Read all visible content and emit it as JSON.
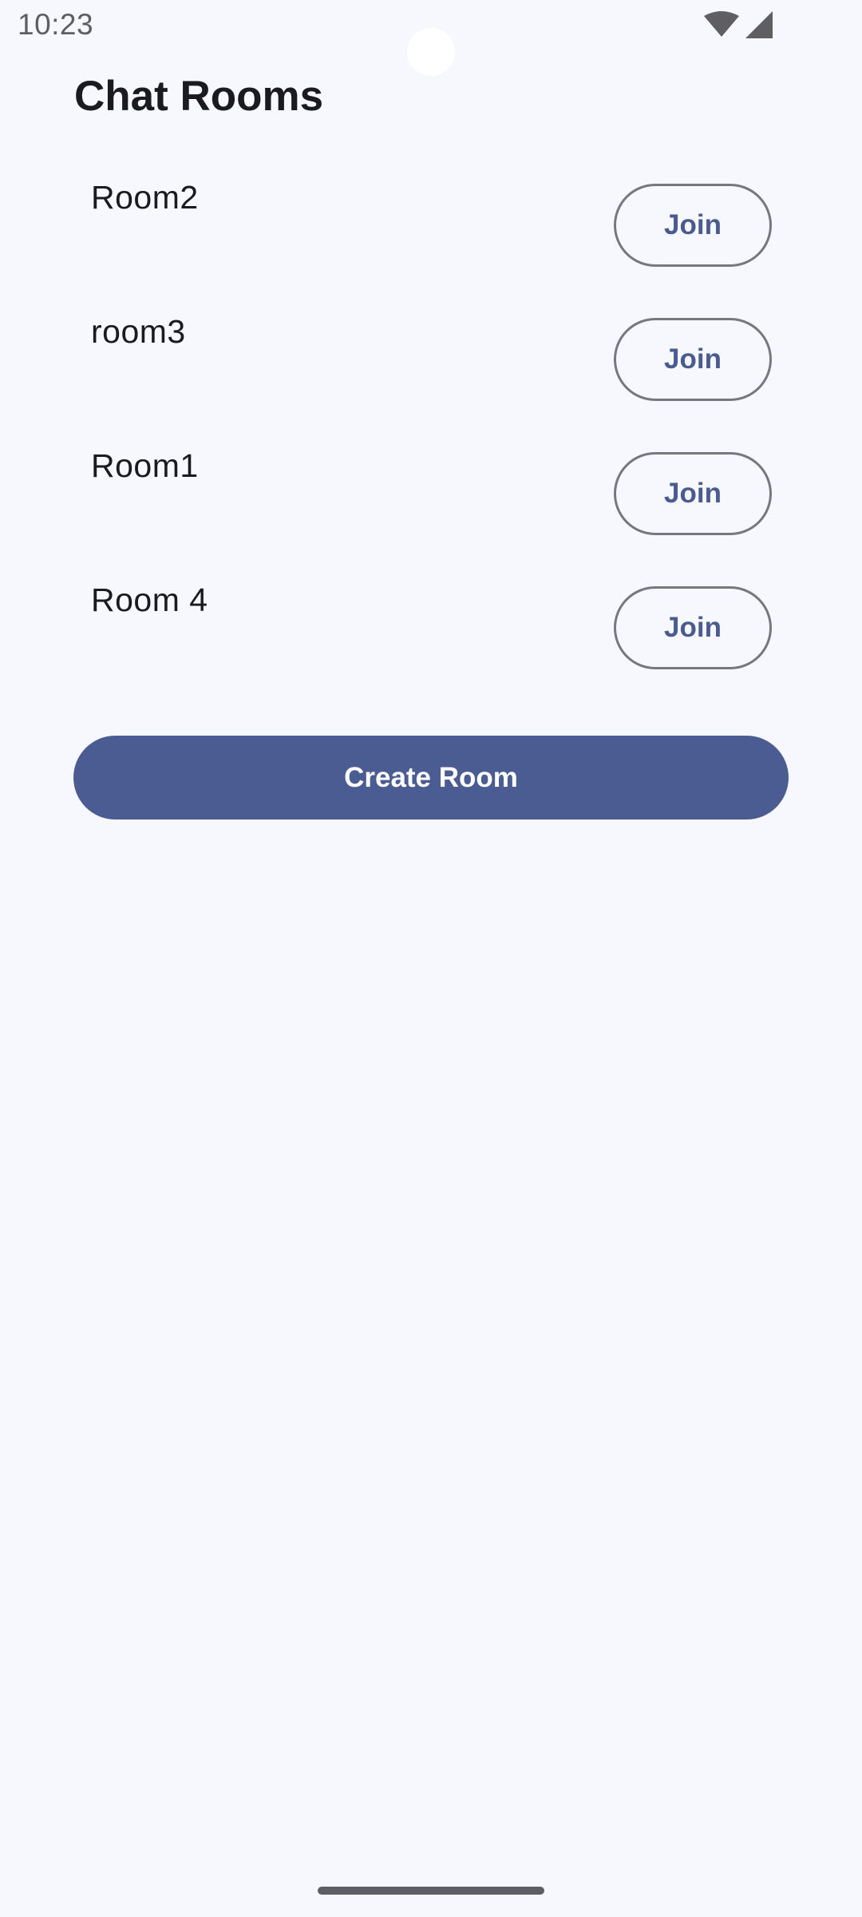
{
  "status_bar": {
    "time": "10:23",
    "icons": [
      "wifi-icon",
      "cellular-signal-icon"
    ]
  },
  "page": {
    "title": "Chat Rooms"
  },
  "rooms": [
    {
      "name": "Room2",
      "action": "Join"
    },
    {
      "name": "room3",
      "action": "Join"
    },
    {
      "name": "Room1",
      "action": "Join"
    },
    {
      "name": "Room 4",
      "action": "Join"
    }
  ],
  "actions": {
    "create_room_label": "Create Room"
  },
  "colors": {
    "background": "#f7f8fd",
    "primary": "#4a5c91",
    "outline": "#76777f",
    "on_surface": "#1b1b1f"
  }
}
